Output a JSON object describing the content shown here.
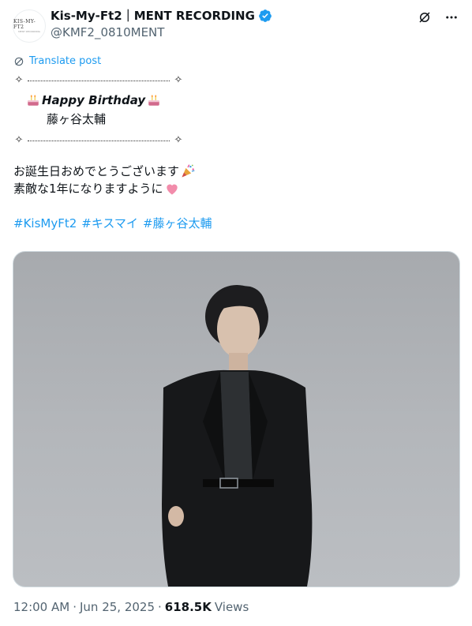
{
  "header": {
    "display_name": "Kis-My-Ft2｜MENT RECORDING",
    "handle": "@KMF2_0810MENT",
    "avatar_text": "KIS-MY-FT2",
    "avatar_subtext": "MENT RECORDING"
  },
  "translate": {
    "label": "Translate post"
  },
  "post": {
    "birthday_text": "Happy Birthday",
    "name_line": "藤ヶ谷太輔",
    "message_line1": "お誕生日おめでとうございます",
    "message_line2": "素敵な1年になりますように",
    "hashtags": [
      "#KisMyFt2",
      "#キスマイ",
      "#藤ヶ谷太輔"
    ]
  },
  "meta": {
    "time": "12:00 AM",
    "separator": "·",
    "date": "Jun 25, 2025",
    "views_count": "618.5K",
    "views_label": "Views"
  },
  "icons": {
    "verified": "verified-badge-icon",
    "grok": "grok-icon",
    "more": "more-icon",
    "translate": "translate-icon",
    "cake": "birthday-cake-icon",
    "party": "party-popper-icon",
    "heart": "pink-heart-icon"
  },
  "colors": {
    "accent": "#1d9bf0",
    "text": "#0f1419",
    "secondary": "#536471"
  }
}
